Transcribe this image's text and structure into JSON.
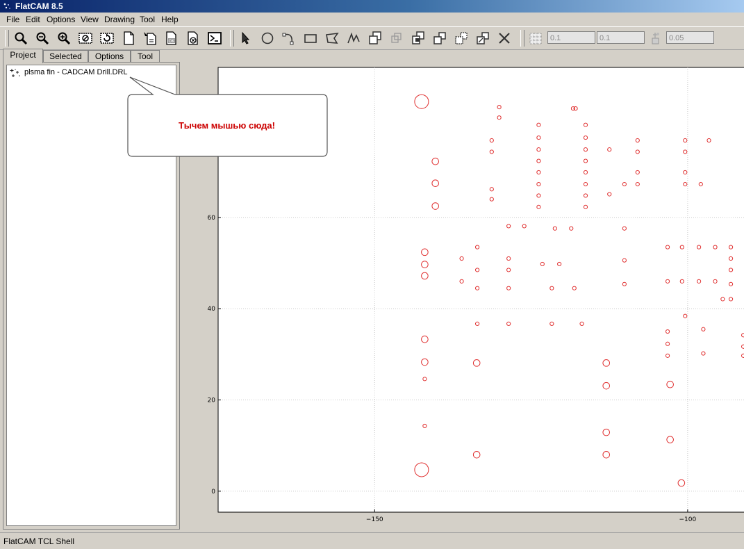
{
  "window": {
    "title": "FlatCAM 8.5"
  },
  "menu": [
    "File",
    "Edit",
    "Options",
    "View",
    "Drawing",
    "Tool",
    "Help"
  ],
  "toolbar": {
    "grid_x": "0.1",
    "grid_y": "0.1",
    "snap_max": "0.05"
  },
  "tabs": [
    "Project",
    "Selected",
    "Options",
    "Tool"
  ],
  "project": {
    "item_label": "plsma fin - CADCAM Drill.DRL"
  },
  "callout": {
    "text": "Тычем мышью сюда!"
  },
  "status": {
    "text": "FlatCAM TCL Shell"
  },
  "colors": {
    "drill": "#e03030",
    "grid": "#c8c8c8"
  },
  "chart_data": {
    "type": "scatter",
    "xlim": [
      -175,
      -91
    ],
    "ylim": [
      -4.6,
      92.9
    ],
    "x_ticks": [
      -150,
      -100
    ],
    "y_ticks": [
      0,
      20,
      40,
      60
    ],
    "holes_r_small": [
      [
        -130.1,
        84.2
      ],
      [
        -130.1,
        81.9
      ],
      [
        -118.3,
        83.9
      ],
      [
        -117.9,
        83.9
      ],
      [
        -131.3,
        76.9
      ],
      [
        -131.3,
        74.4
      ],
      [
        -131.3,
        66.2
      ],
      [
        -131.3,
        64.0
      ],
      [
        -123.8,
        80.3
      ],
      [
        -123.8,
        77.5
      ],
      [
        -123.8,
        74.9
      ],
      [
        -123.8,
        72.4
      ],
      [
        -123.8,
        69.9
      ],
      [
        -123.8,
        67.3
      ],
      [
        -123.8,
        64.8
      ],
      [
        -123.8,
        62.3
      ],
      [
        -116.3,
        80.3
      ],
      [
        -116.3,
        77.5
      ],
      [
        -116.3,
        74.9
      ],
      [
        -116.3,
        72.4
      ],
      [
        -116.3,
        69.9
      ],
      [
        -116.3,
        67.3
      ],
      [
        -116.3,
        64.8
      ],
      [
        -116.3,
        62.3
      ],
      [
        -112.5,
        74.9
      ],
      [
        -112.5,
        65.1
      ],
      [
        -110.1,
        67.3
      ],
      [
        -108.0,
        76.9
      ],
      [
        -108.0,
        74.4
      ],
      [
        -108.0,
        69.9
      ],
      [
        -108.0,
        67.3
      ],
      [
        -100.4,
        76.9
      ],
      [
        -100.4,
        74.4
      ],
      [
        -100.4,
        69.9
      ],
      [
        -100.4,
        67.3
      ],
      [
        -97.9,
        67.3
      ],
      [
        -96.6,
        76.9
      ],
      [
        -128.6,
        58.1
      ],
      [
        -126.1,
        58.1
      ],
      [
        -121.2,
        57.6
      ],
      [
        -118.6,
        57.6
      ],
      [
        -110.1,
        57.6
      ],
      [
        -133.6,
        53.5
      ],
      [
        -136.1,
        51.0
      ],
      [
        -128.6,
        51.0
      ],
      [
        -133.6,
        48.5
      ],
      [
        -128.6,
        48.5
      ],
      [
        -123.2,
        49.8
      ],
      [
        -120.5,
        49.8
      ],
      [
        -110.1,
        50.6
      ],
      [
        -136.1,
        46.0
      ],
      [
        -133.6,
        44.5
      ],
      [
        -128.6,
        44.5
      ],
      [
        -121.7,
        44.5
      ],
      [
        -118.1,
        44.5
      ],
      [
        -110.1,
        45.4
      ],
      [
        -103.2,
        53.5
      ],
      [
        -100.9,
        53.5
      ],
      [
        -98.2,
        53.5
      ],
      [
        -95.6,
        53.5
      ],
      [
        -103.2,
        46.0
      ],
      [
        -100.9,
        46.0
      ],
      [
        -98.2,
        46.0
      ],
      [
        -95.6,
        46.0
      ],
      [
        -94.4,
        42.1
      ],
      [
        -133.6,
        36.7
      ],
      [
        -128.6,
        36.7
      ],
      [
        -121.7,
        36.7
      ],
      [
        -116.9,
        36.7
      ],
      [
        -100.4,
        38.4
      ],
      [
        -103.2,
        35.0
      ],
      [
        -103.2,
        32.3
      ],
      [
        -103.2,
        29.7
      ],
      [
        -97.5,
        35.5
      ],
      [
        -97.5,
        30.2
      ],
      [
        -142.0,
        24.6
      ],
      [
        -142.0,
        14.3
      ]
    ],
    "holes_r_medium": [
      [
        -140.3,
        72.3
      ],
      [
        -140.3,
        67.5
      ],
      [
        -140.3,
        62.5
      ],
      [
        -142.0,
        52.4
      ],
      [
        -142.0,
        49.7
      ],
      [
        -142.0,
        47.2
      ],
      [
        -142.0,
        33.3
      ],
      [
        -142.0,
        28.3
      ],
      [
        -133.7,
        28.1
      ],
      [
        -113.0,
        28.1
      ],
      [
        -113.0,
        23.1
      ],
      [
        -113.0,
        12.9
      ],
      [
        -113.0,
        8.0
      ],
      [
        -133.7,
        8.0
      ],
      [
        -102.8,
        23.4
      ],
      [
        -102.8,
        11.3
      ],
      [
        -101.0,
        1.8
      ]
    ],
    "holes_r_large": [
      [
        -142.5,
        85.4
      ],
      [
        -142.5,
        4.7
      ]
    ]
  }
}
